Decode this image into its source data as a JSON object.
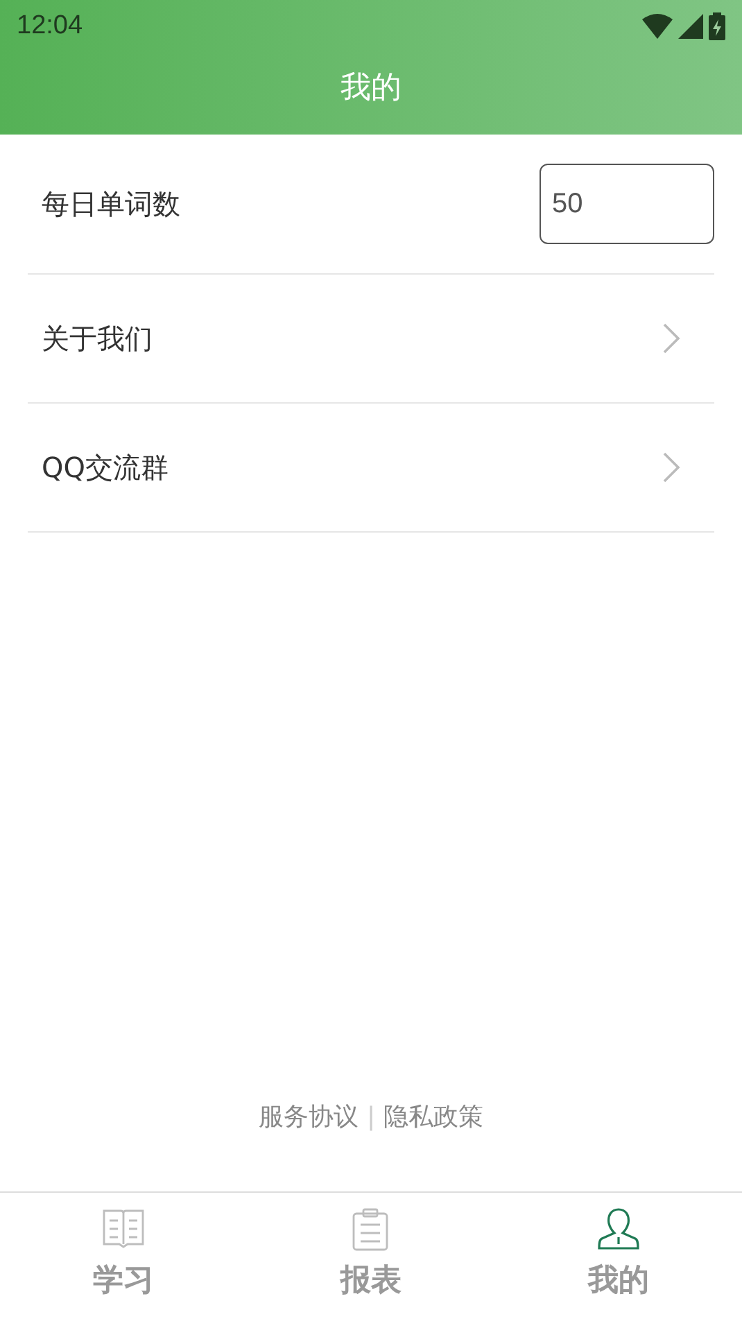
{
  "status_bar": {
    "time": "12:04"
  },
  "header": {
    "title": "我的"
  },
  "settings": [
    {
      "kind": "input",
      "label": "每日单词数",
      "value": "50"
    },
    {
      "kind": "link",
      "label": "关于我们"
    },
    {
      "kind": "link",
      "label": "QQ交流群"
    }
  ],
  "footer_links": {
    "items": [
      "服务协议",
      "隐私政策"
    ],
    "separator": "|"
  },
  "bottom_nav": [
    {
      "label": "学习",
      "selected": false,
      "kind": "book"
    },
    {
      "label": "报表",
      "selected": false,
      "kind": "clipboard"
    },
    {
      "label": "我的",
      "selected": true,
      "kind": "person"
    }
  ]
}
